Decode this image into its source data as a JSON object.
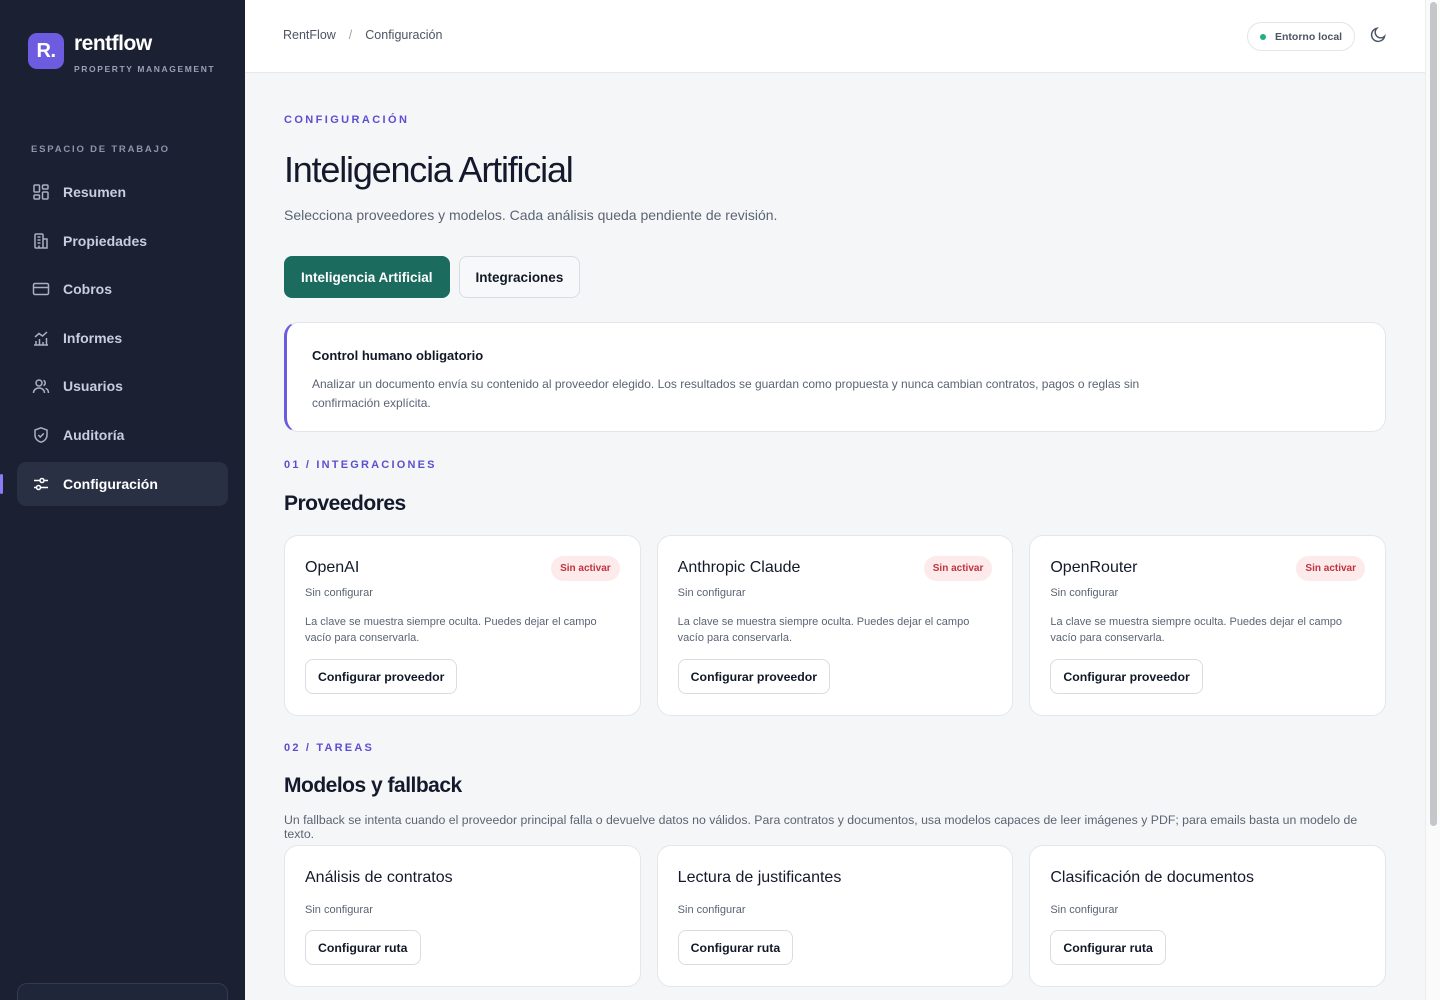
{
  "brand": {
    "logo_text": "R.",
    "name": "rentflow",
    "subtitle": "PROPERTY MANAGEMENT"
  },
  "sidebar": {
    "section_label": "ESPACIO DE TRABAJO",
    "items": [
      {
        "label": "Resumen",
        "icon": "grid-icon"
      },
      {
        "label": "Propiedades",
        "icon": "building-icon"
      },
      {
        "label": "Cobros",
        "icon": "credit-card-icon"
      },
      {
        "label": "Informes",
        "icon": "chart-icon"
      },
      {
        "label": "Usuarios",
        "icon": "users-icon"
      },
      {
        "label": "Auditoría",
        "icon": "shield-check-icon"
      },
      {
        "label": "Configuración",
        "icon": "sliders-icon",
        "active": true
      }
    ]
  },
  "topbar": {
    "breadcrumb": [
      "RentFlow",
      "/",
      "Configuración"
    ],
    "env_label": "Entorno local",
    "theme_icon": "moon-icon"
  },
  "page": {
    "eyebrow": "CONFIGURACIÓN",
    "title": "Inteligencia Artificial",
    "subtitle": "Selecciona proveedores y modelos. Cada análisis queda pendiente de revisión.",
    "tabs": [
      {
        "label": "Inteligencia Artificial",
        "active": true
      },
      {
        "label": "Integraciones",
        "active": false
      }
    ]
  },
  "notice": {
    "title": "Control humano obligatorio",
    "text": "Analizar un documento envía su contenido al proveedor elegido. Los resultados se guardan como propuesta y nunca cambian contratos, pagos o reglas sin confirmación explícita."
  },
  "providers": {
    "label": "01 / INTEGRACIONES",
    "title": "Proveedores",
    "cards": [
      {
        "name": "OpenAI",
        "badge": "Sin activar",
        "status": "Sin configurar",
        "desc": "La clave se muestra siempre oculta. Puedes dejar el campo vacío para conservarla.",
        "button": "Configurar proveedor"
      },
      {
        "name": "Anthropic Claude",
        "badge": "Sin activar",
        "status": "Sin configurar",
        "desc": "La clave se muestra siempre oculta. Puedes dejar el campo vacío para conservarla.",
        "button": "Configurar proveedor"
      },
      {
        "name": "OpenRouter",
        "badge": "Sin activar",
        "status": "Sin configurar",
        "desc": "La clave se muestra siempre oculta. Puedes dejar el campo vacío para conservarla.",
        "button": "Configurar proveedor"
      }
    ]
  },
  "tasks": {
    "label": "02 / TAREAS",
    "title": "Modelos y fallback",
    "desc": "Un fallback se intenta cuando el proveedor principal falla o devuelve datos no válidos. Para contratos y documentos, usa modelos capaces de leer imágenes y PDF; para emails basta un modelo de texto.",
    "cards": [
      {
        "name": "Análisis de contratos",
        "status": "Sin configurar",
        "button": "Configurar ruta"
      },
      {
        "name": "Lectura de justificantes",
        "status": "Sin configurar",
        "button": "Configurar ruta"
      },
      {
        "name": "Clasificación de documentos",
        "status": "Sin configurar",
        "button": "Configurar ruta"
      }
    ]
  },
  "colors": {
    "sidebar_bg": "#1b2032",
    "accent": "#6d5ce0",
    "primary_button": "#1b6b5e",
    "badge_red": "#c0343f",
    "status_dot": "#22b07d"
  }
}
